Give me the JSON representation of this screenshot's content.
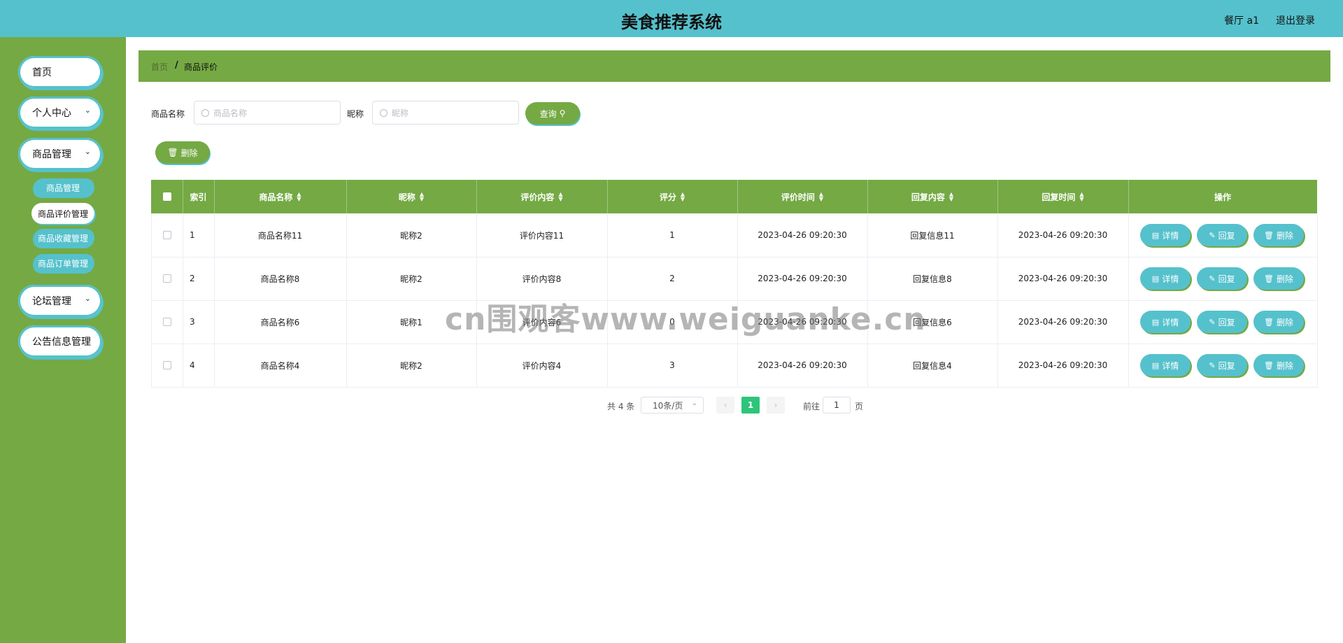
{
  "header": {
    "title": "美食推荐系统",
    "user": "餐厅 a1",
    "logout": "退出登录"
  },
  "sidebar": {
    "items": [
      {
        "label": "首页"
      },
      {
        "label": "个人中心",
        "chevron": "chevron-down-icon"
      },
      {
        "label": "商品管理",
        "chevron": "chevron-down-icon"
      },
      {
        "label": "论坛管理",
        "chevron": "chevron-down-icon"
      },
      {
        "label": "公告信息管理"
      }
    ],
    "subitems": [
      {
        "label": "商品管理"
      },
      {
        "label": "商品评价管理"
      },
      {
        "label": "商品收藏管理"
      },
      {
        "label": "商品订单管理"
      }
    ]
  },
  "breadcrumb": {
    "home": "首页",
    "separator": "/",
    "current": "商品评价"
  },
  "search": {
    "name_label": "商品名称",
    "name_placeholder": "商品名称",
    "nick_label": "昵称",
    "nick_placeholder": "昵称",
    "query_button": "查询",
    "delete_button": "删除"
  },
  "table": {
    "headers": [
      "索引",
      "商品名称",
      "昵称",
      "评价内容",
      "评分",
      "评价时间",
      "回复内容",
      "回复时间",
      "操作"
    ],
    "rows": [
      {
        "index": "1",
        "name": "商品名称11",
        "nick": "昵称2",
        "content": "评价内容11",
        "score": "1",
        "time": "2023-04-26 09:20:30",
        "reply": "回复信息11",
        "reply_time": "2023-04-26 09:20:30"
      },
      {
        "index": "2",
        "name": "商品名称8",
        "nick": "昵称2",
        "content": "评价内容8",
        "score": "2",
        "time": "2023-04-26 09:20:30",
        "reply": "回复信息8",
        "reply_time": "2023-04-26 09:20:30"
      },
      {
        "index": "3",
        "name": "商品名称6",
        "nick": "昵称1",
        "content": "评价内容6",
        "score": "0",
        "time": "2023-04-26 09:20:30",
        "reply": "回复信息6",
        "reply_time": "2023-04-26 09:20:30"
      },
      {
        "index": "4",
        "name": "商品名称4",
        "nick": "昵称2",
        "content": "评价内容4",
        "score": "3",
        "time": "2023-04-26 09:20:30",
        "reply": "回复信息4",
        "reply_time": "2023-04-26 09:20:30"
      }
    ],
    "actions": {
      "detail": "详情",
      "reply": "回复",
      "delete": "删除"
    }
  },
  "pagination": {
    "total": "共 4 条",
    "page_size": "10条/页",
    "current": "1",
    "goto_label": "前往",
    "goto_value": "1",
    "page_suffix": "页",
    "prev": "‹",
    "next": "›"
  },
  "watermark": "cn围观客www.weiguanke.cn",
  "colors": {
    "header": "#55c1cc",
    "green": "#74a944",
    "teal": "#55c1cc",
    "active_page": "#2ec57a"
  }
}
